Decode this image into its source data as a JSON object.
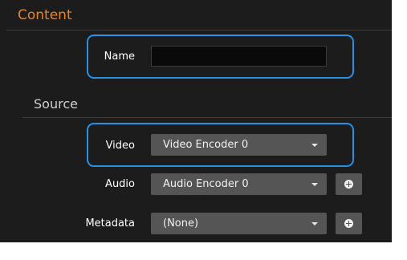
{
  "content": {
    "title": "Content",
    "name_label": "Name",
    "name_value": ""
  },
  "source": {
    "title": "Source",
    "video_label": "Video",
    "video_value": "Video Encoder 0",
    "audio_label": "Audio",
    "audio_value": "Audio Encoder 0",
    "metadata_label": "Metadata",
    "metadata_value": "(None)"
  },
  "colors": {
    "accent": "#e8832a",
    "highlight": "#2a8fe0",
    "panel": "#1c1c1c",
    "control": "#555555"
  },
  "icons": [
    "chevron-down-icon",
    "plus-circle-icon"
  ]
}
